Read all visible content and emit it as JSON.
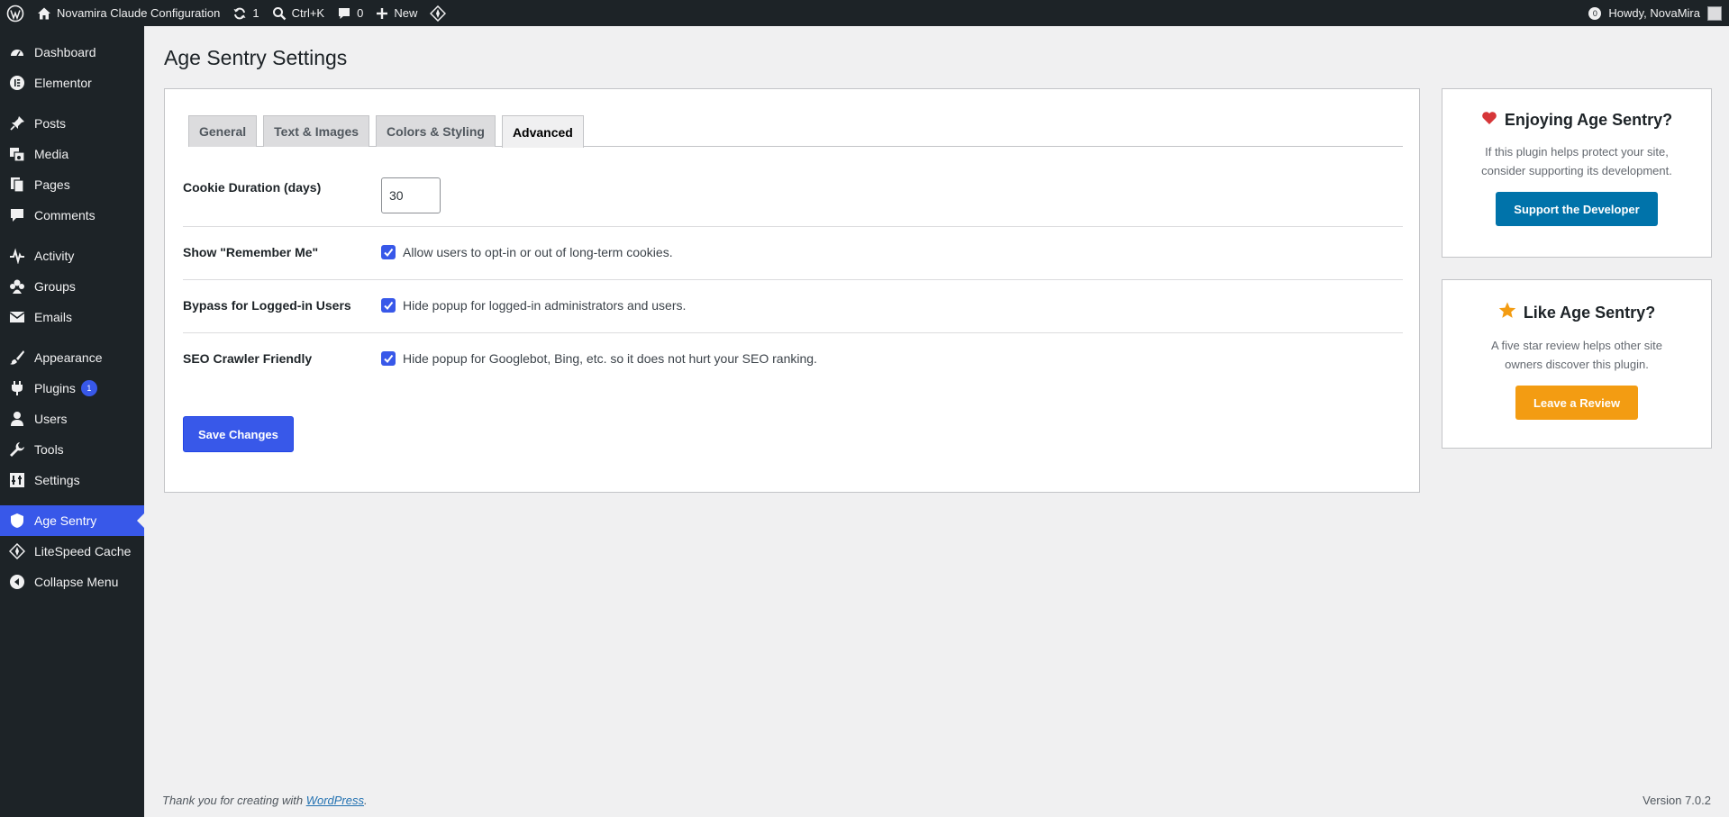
{
  "adminbar": {
    "site_name": "Novamira Claude Configuration",
    "updates_count": "1",
    "search_shortcut": "Ctrl+K",
    "comments_count": "0",
    "new_label": "New",
    "notifications_count": "0",
    "greeting": "Howdy, NovaMira"
  },
  "sidebar": {
    "items": [
      {
        "label": "Dashboard",
        "icon": "dashboard-icon"
      },
      {
        "label": "Elementor",
        "icon": "elementor-icon"
      },
      {
        "label": "Posts",
        "icon": "pin-icon"
      },
      {
        "label": "Media",
        "icon": "media-icon"
      },
      {
        "label": "Pages",
        "icon": "pages-icon"
      },
      {
        "label": "Comments",
        "icon": "comment-icon"
      },
      {
        "label": "Activity",
        "icon": "activity-icon"
      },
      {
        "label": "Groups",
        "icon": "groups-icon"
      },
      {
        "label": "Emails",
        "icon": "email-icon"
      },
      {
        "label": "Appearance",
        "icon": "brush-icon"
      },
      {
        "label": "Plugins",
        "icon": "plugin-icon",
        "badge": "1"
      },
      {
        "label": "Users",
        "icon": "user-icon"
      },
      {
        "label": "Tools",
        "icon": "wrench-icon"
      },
      {
        "label": "Settings",
        "icon": "settings-icon"
      },
      {
        "label": "Age Sentry",
        "icon": "shield-icon",
        "current": true
      },
      {
        "label": "LiteSpeed Cache",
        "icon": "litespeed-icon"
      },
      {
        "label": "Collapse Menu",
        "icon": "collapse-icon"
      }
    ]
  },
  "page": {
    "title": "Age Sentry Settings",
    "tabs": [
      {
        "label": "General"
      },
      {
        "label": "Text & Images"
      },
      {
        "label": "Colors & Styling"
      },
      {
        "label": "Advanced",
        "active": true
      }
    ],
    "fields": {
      "cookie_duration": {
        "label": "Cookie Duration (days)",
        "value": "30"
      },
      "remember_me": {
        "label": "Show \"Remember Me\"",
        "checked": true,
        "description": "Allow users to opt-in or out of long-term cookies."
      },
      "bypass_logged_in": {
        "label": "Bypass for Logged-in Users",
        "checked": true,
        "description": "Hide popup for logged-in administrators and users."
      },
      "seo_crawler": {
        "label": "SEO Crawler Friendly",
        "checked": true,
        "description": "Hide popup for Googlebot, Bing, etc. so it does not hurt your SEO ranking."
      }
    },
    "save_label": "Save Changes"
  },
  "promos": {
    "enjoying": {
      "title": "Enjoying Age Sentry?",
      "text_line1": "If this plugin helps protect your site,",
      "text_line2": "consider supporting its development.",
      "button": "Support the Developer",
      "button_color": "#0073aa",
      "icon": "heart-icon",
      "icon_color": "#d63638"
    },
    "review": {
      "title": "Like Age Sentry?",
      "text_line1": "A five star review helps other site",
      "text_line2": "owners discover this plugin.",
      "button": "Leave a Review",
      "button_color": "#f39c12",
      "icon": "star-icon",
      "icon_color": "#f39c12"
    }
  },
  "footer": {
    "thanks_prefix": "Thank you for creating with",
    "thanks_link": "WordPress",
    "thanks_suffix": ".",
    "version": "Version 7.0.2"
  },
  "colors": {
    "accent": "#3858e9",
    "sidebar_bg": "#1d2327",
    "page_bg": "#f0f0f1"
  }
}
